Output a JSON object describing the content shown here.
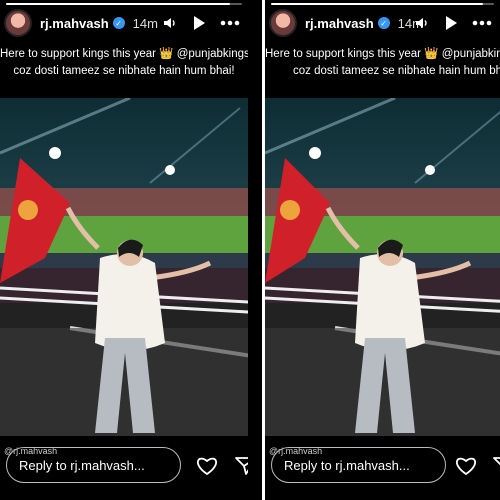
{
  "story": {
    "username": "rj.mahvash",
    "time_ago": "14m",
    "caption_line1_prefix": "Here to support kings this year",
    "crown_emoji": "👑",
    "mention": "@punjabkingsipl",
    "trophy_emoji": "🏆",
    "caption_line2": "coz dosti tameez se nibhate hain hum bhai!",
    "credit": "@rj.mahvash",
    "reply_placeholder": "Reply to rj.mahvash...",
    "progress": 0.95
  },
  "icons": [
    "speaker-icon",
    "play-icon",
    "more-icon",
    "heart-icon",
    "send-icon",
    "verified-badge-icon"
  ],
  "colors": {
    "flag_red": "#d0202a",
    "stadium_field": "#4e9a3a",
    "verified_blue": "#3897f0"
  }
}
